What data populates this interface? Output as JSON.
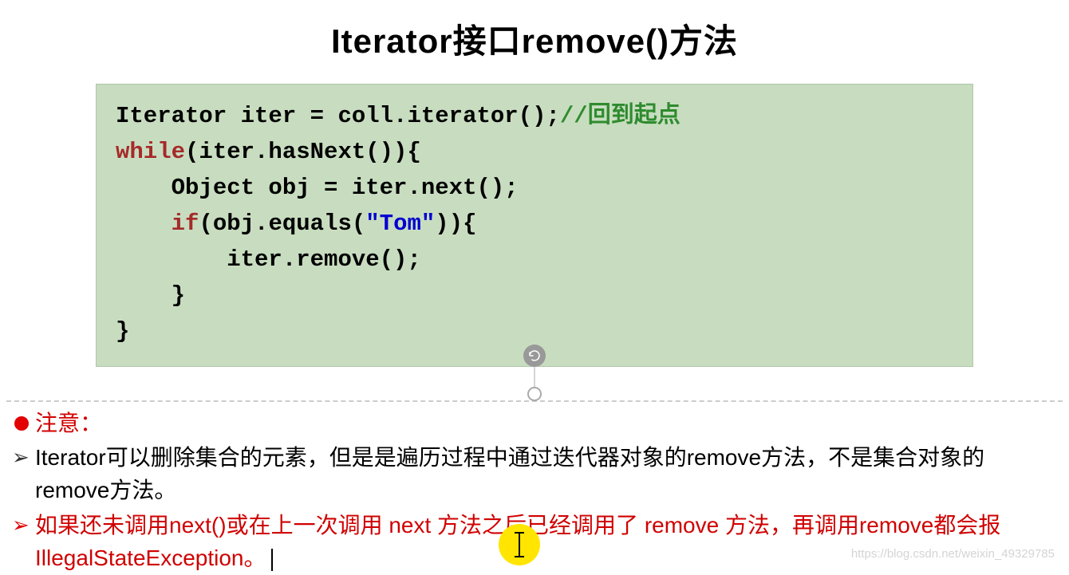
{
  "title": "Iterator接口remove()方法",
  "code": {
    "line1_pre": "Iterator iter = coll.iterator();",
    "line1_comment": "//回到起点",
    "line2_kw": "while",
    "line2_rest": "(iter.hasNext()){",
    "line3": "    Object obj = iter.next();",
    "line4_indent": "    ",
    "line4_kw": "if",
    "line4_mid": "(obj.equals(",
    "line4_str": "\"Tom\"",
    "line4_end": ")){",
    "line5": "        iter.remove();",
    "line6": "    }",
    "line7": "}"
  },
  "notes": {
    "attention": "注意：",
    "item1": "Iterator可以删除集合的元素，但是是遍历过程中通过迭代器对象的remove方法，不是集合对象的remove方法。",
    "item2": "如果还未调用next()或在上一次调用 next 方法之后已经调用了 remove 方法，再调用remove都会报IllegalStateException。"
  },
  "watermark": "https://blog.csdn.net/weixin_49329785"
}
